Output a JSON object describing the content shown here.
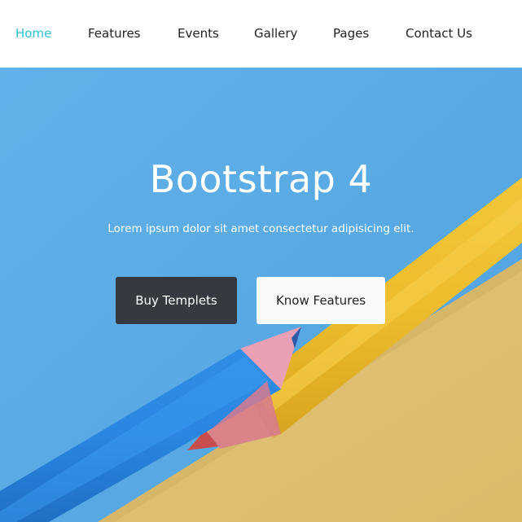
{
  "nav": {
    "items": [
      {
        "label": "Home",
        "active": true
      },
      {
        "label": "Features",
        "active": false
      },
      {
        "label": "Events",
        "active": false
      },
      {
        "label": "Gallery",
        "active": false
      },
      {
        "label": "Pages",
        "active": false
      },
      {
        "label": "Contact Us",
        "active": false
      }
    ],
    "active_color": "#2bc5d4"
  },
  "hero": {
    "title": "Bootstrap 4",
    "subtitle": "Lorem ipsum dolor sit amet consectetur adipisicing elit.",
    "primary_button": "Buy Templets",
    "secondary_button": "Know Features",
    "background": "blue-and-yellow-colored-pencils-photo"
  }
}
